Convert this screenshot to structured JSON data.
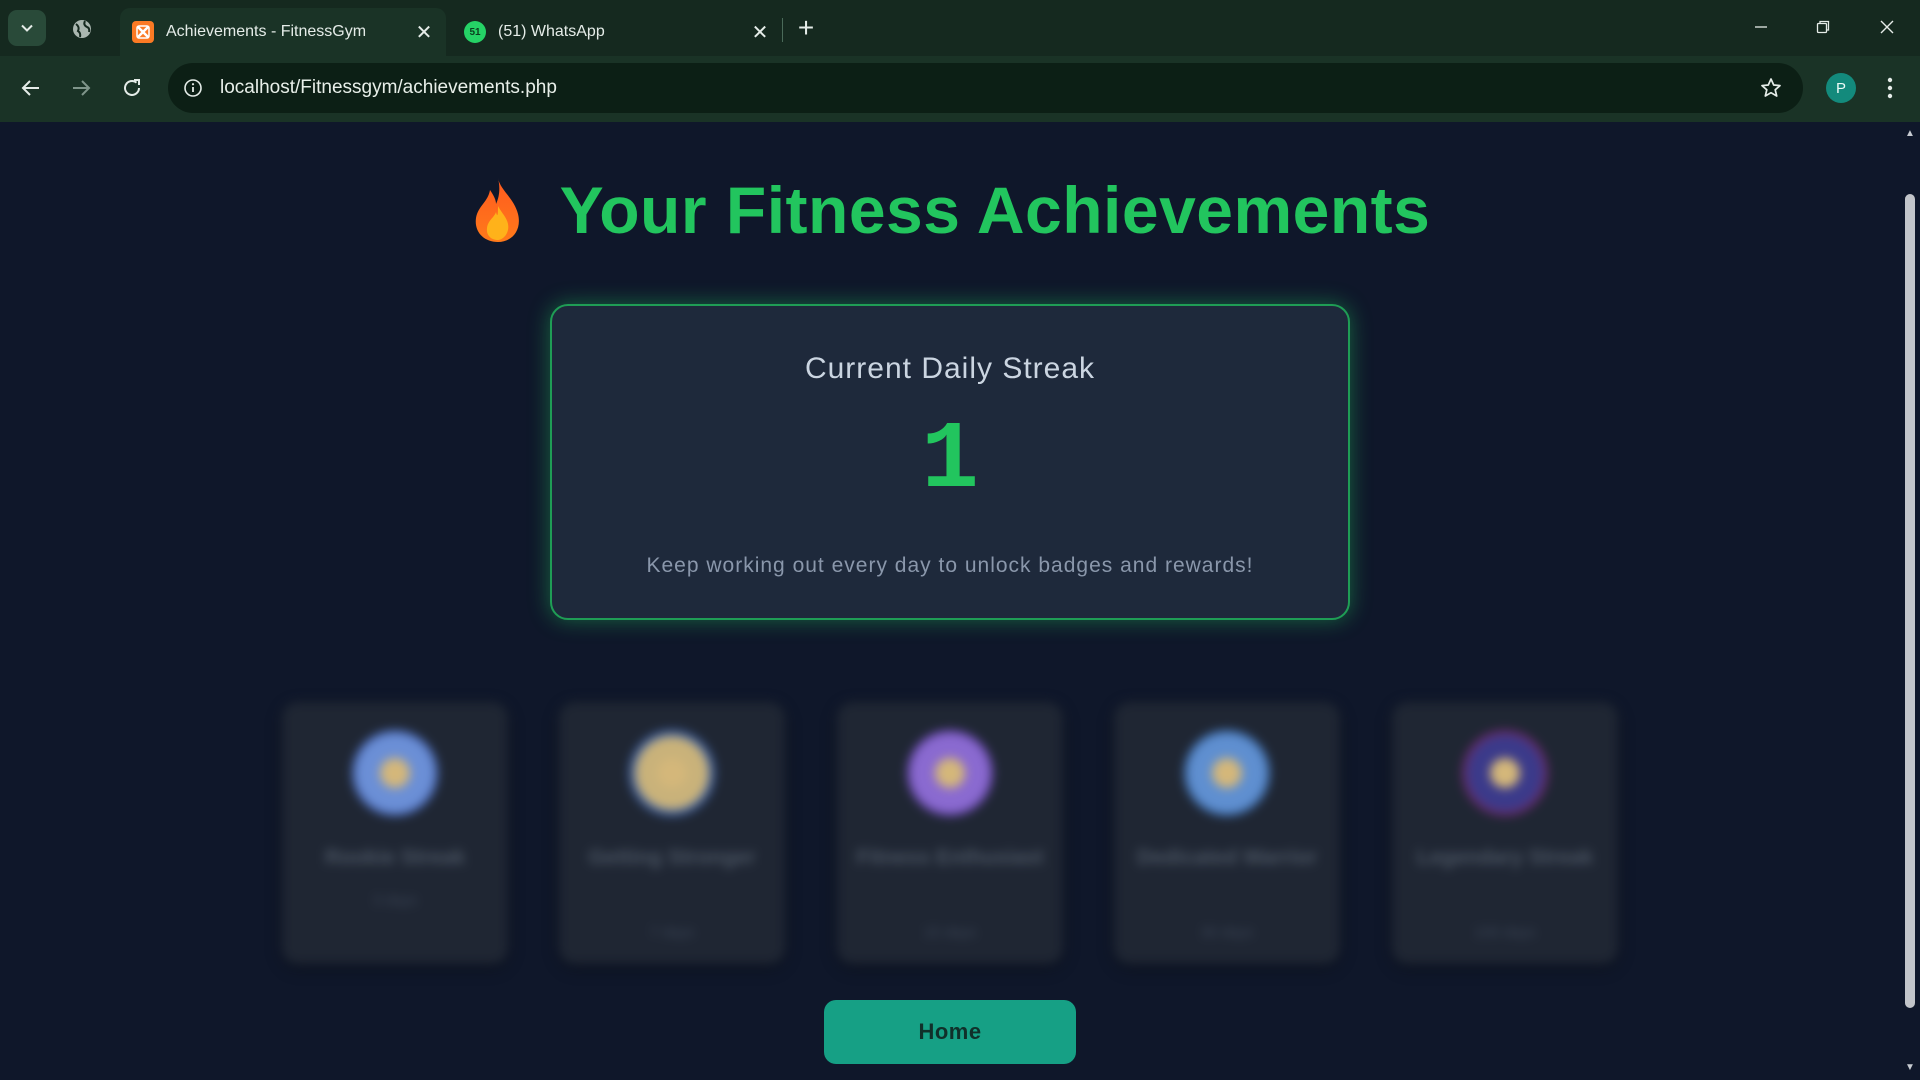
{
  "browser": {
    "tabs": [
      {
        "title": "Achievements - FitnessGym",
        "active": true,
        "favicon": "xampp-icon",
        "favicon_color": "#fb7a24"
      },
      {
        "title": "(51) WhatsApp",
        "active": false,
        "favicon": "whatsapp-icon",
        "favicon_color": "#25d366",
        "favicon_text": "51"
      }
    ],
    "url": "localhost/Fitnessgym/achievements.php",
    "profile_initial": "P"
  },
  "page": {
    "title": "Your Fitness Achievements",
    "title_icon": "flame-icon",
    "streak": {
      "label": "Current Daily Streak",
      "count": "1",
      "note": "Keep working out every day to unlock badges and rewards!"
    },
    "badges": [
      {
        "title": "Rookie Streak",
        "days": "3 days",
        "medal_color": "#6b8fd6"
      },
      {
        "title": "Getting Stronger",
        "days": "7 days",
        "medal_color": "#c9b27a"
      },
      {
        "title": "Fitness Enthusiast",
        "days": "15 days",
        "medal_color": "#8a6ad0"
      },
      {
        "title": "Dedicated Warrior",
        "days": "30 days",
        "medal_color": "#5f8fd0"
      },
      {
        "title": "Legendary Streak",
        "days": "100 days",
        "medal_color": "#3b3a8a"
      }
    ],
    "home_button": "Home"
  },
  "colors": {
    "accent_green": "#22c55e",
    "page_background": "#0f172a",
    "card_background": "#1e293b",
    "home_button": "#16a085"
  }
}
